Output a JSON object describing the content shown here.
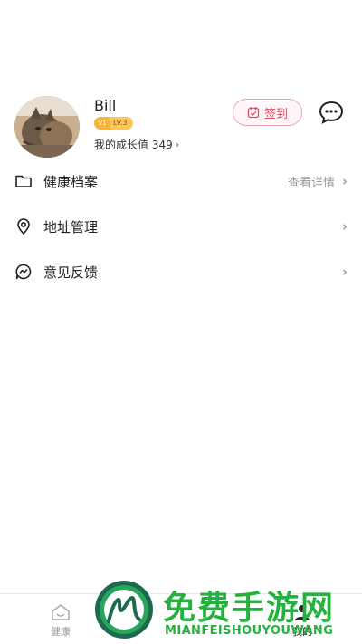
{
  "profile": {
    "username": "Bill",
    "vip_badge": "V1",
    "level_badge": "LV.3",
    "growth_label": "我的成长值 349",
    "checkin_label": "签到"
  },
  "menu": {
    "items": [
      {
        "label": "健康档案",
        "right_text": "查看详情",
        "icon": "folder-icon"
      },
      {
        "label": "地址管理",
        "right_text": "",
        "icon": "location-pin-icon"
      },
      {
        "label": "意见反馈",
        "right_text": "",
        "icon": "feedback-icon"
      }
    ]
  },
  "tabbar": {
    "tabs": [
      {
        "label": "健康",
        "icon": "health-icon",
        "active": false
      },
      {
        "label": "我的",
        "icon": "person-icon",
        "active": true
      }
    ]
  },
  "watermark": {
    "title": "免费手游网",
    "subtitle": "MIANFEISHOUYOUWANG"
  },
  "colors": {
    "checkin_accent": "#e4475f",
    "badge_gold": "#fbc659",
    "watermark_green": "#23b23d"
  }
}
